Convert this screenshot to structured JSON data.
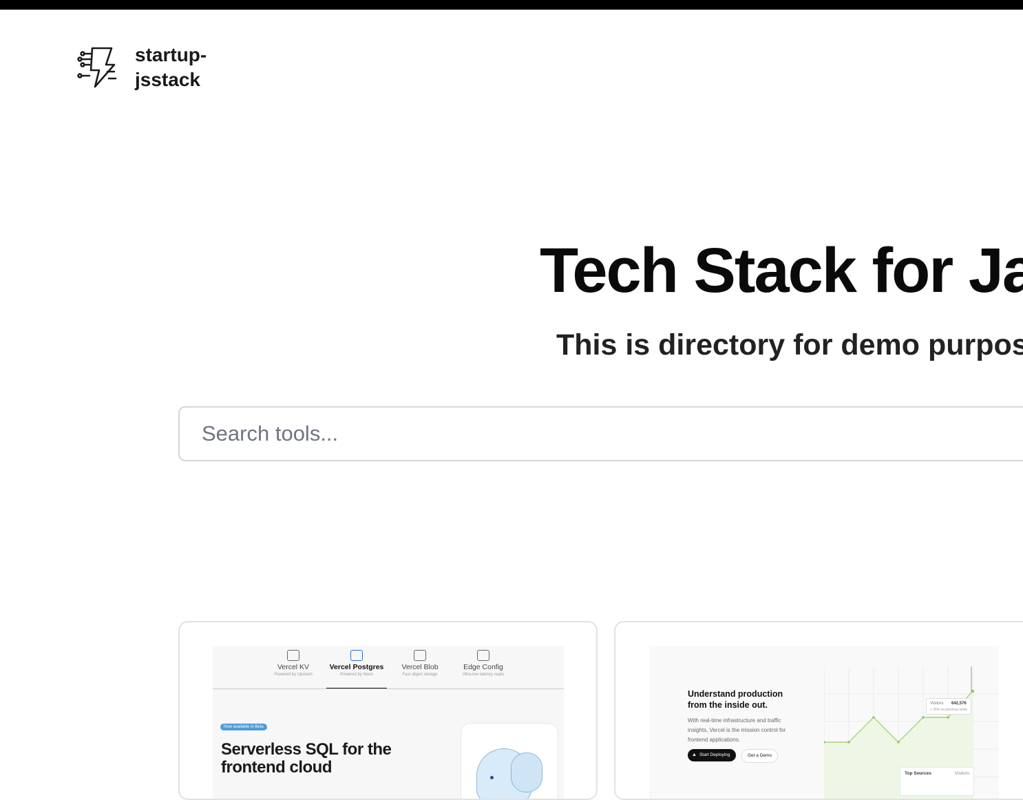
{
  "header": {
    "brand_line1": "startup-",
    "brand_line2": "jsstack"
  },
  "hero": {
    "title": "Tech Stack for Jav",
    "subtitle": "This is directory for demo purpose"
  },
  "search": {
    "placeholder": "Search tools..."
  },
  "cards": [
    {
      "screenshot": {
        "tabs": [
          {
            "label": "Vercel KV",
            "subtitle": "Powered by Upstash",
            "active": false
          },
          {
            "label": "Vercel Postgres",
            "subtitle": "Powered by Neon",
            "active": true
          },
          {
            "label": "Vercel Blob",
            "subtitle": "Fast object storage",
            "active": false
          },
          {
            "label": "Edge Config",
            "subtitle": "Ultra-low latency reads",
            "active": false
          }
        ],
        "badge": "Now available in Beta",
        "heading": "Serverless SQL for the frontend cloud"
      }
    },
    {
      "screenshot": {
        "heading": "Understand production from the inside out.",
        "body": "With real-time infrastructure and traffic insights, Vercel is the mission control for frontend applications.",
        "primary_button": "Start Deploying",
        "secondary_button": "Get a Demo",
        "tooltip_label": "Visitors",
        "tooltip_value": "642,576",
        "tooltip_caption": "+ 35% vs previous week",
        "sources_title": "Top Sources",
        "sources_column": "Visitors"
      }
    }
  ],
  "colors": {
    "topbar": "#000000",
    "text_primary": "#0a0a0a",
    "border": "#d6d6d6",
    "chart_line": "#a6d67a",
    "active_tab_icon": "#2b6ad8",
    "badge": "#4f9bd6"
  }
}
